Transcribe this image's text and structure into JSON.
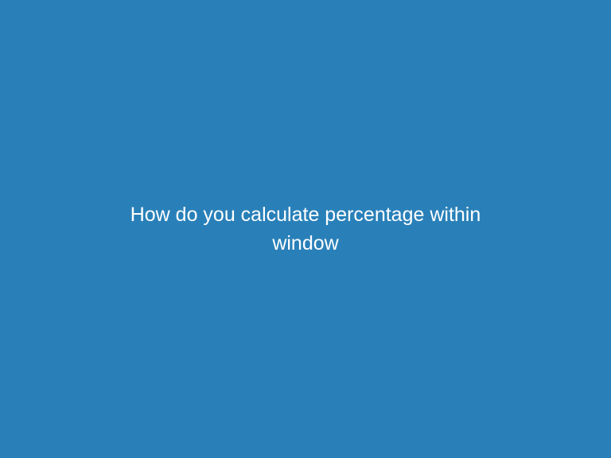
{
  "title": "How do you calculate percentage within window",
  "colors": {
    "background": "#2980b9",
    "text": "#ffffff"
  }
}
